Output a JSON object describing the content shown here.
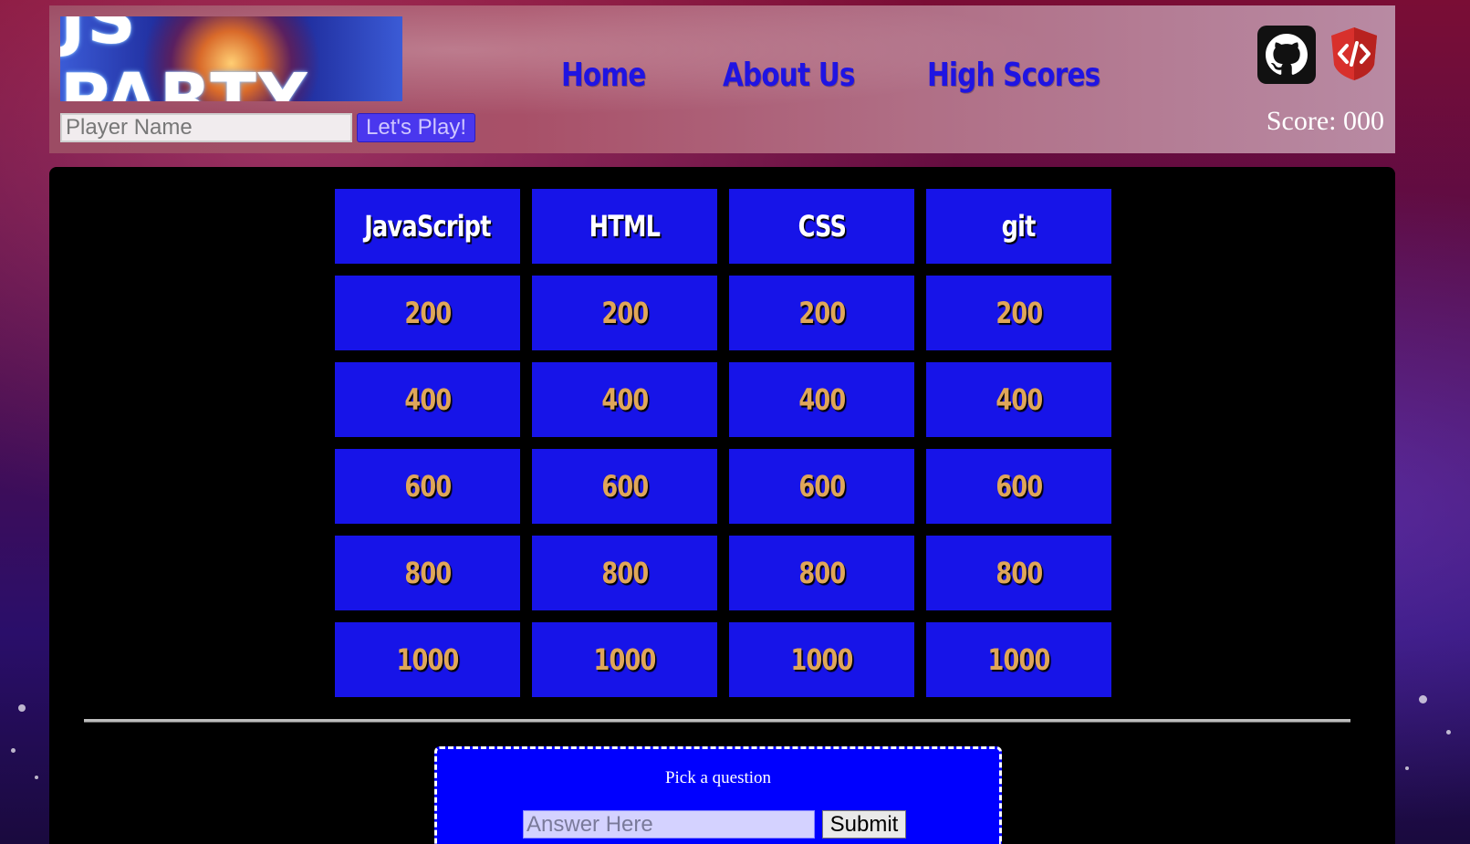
{
  "header": {
    "logo_text": "JS PARTY",
    "player_name_placeholder": "Player Name",
    "play_button_label": "Let's Play!",
    "nav": [
      {
        "label": "Home"
      },
      {
        "label": "About Us"
      },
      {
        "label": "High Scores"
      }
    ],
    "icons": [
      "github-icon",
      "code-shield-icon"
    ],
    "score_text": "Score: 000"
  },
  "board": {
    "categories": [
      "JavaScript",
      "HTML",
      "CSS",
      "git"
    ],
    "values": [
      "200",
      "400",
      "600",
      "800",
      "1000"
    ]
  },
  "answer_panel": {
    "prompt": "Pick a question",
    "answer_placeholder": "Answer Here",
    "submit_label": "Submit"
  },
  "colors": {
    "tile_blue": "#1714e8",
    "value_gold": "#dfa659",
    "nav_blue": "#1f14e2",
    "answer_panel_blue": "#0000ff"
  }
}
